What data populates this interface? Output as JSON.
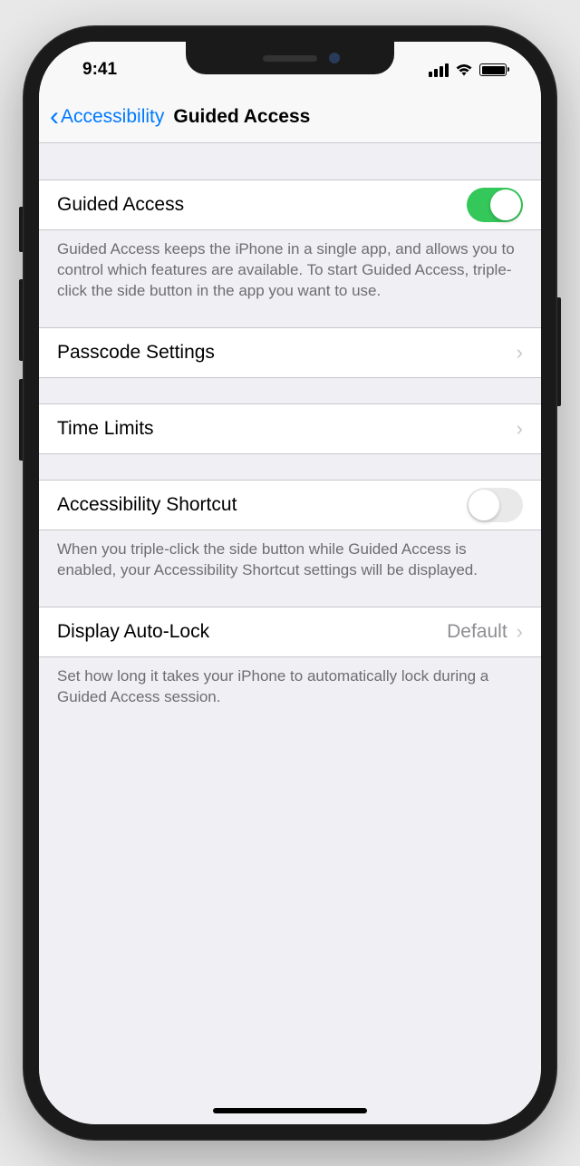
{
  "statusBar": {
    "time": "9:41"
  },
  "navBar": {
    "backLabel": "Accessibility",
    "title": "Guided Access"
  },
  "rows": {
    "guidedAccess": {
      "label": "Guided Access",
      "enabled": true,
      "footer": "Guided Access keeps the iPhone in a single app, and allows you to control which features are available. To start Guided Access, triple-click the side button in the app you want to use."
    },
    "passcode": {
      "label": "Passcode Settings"
    },
    "timeLimits": {
      "label": "Time Limits"
    },
    "accessibilityShortcut": {
      "label": "Accessibility Shortcut",
      "enabled": false,
      "footer": "When you triple-click the side button while Guided Access is enabled, your Accessibility Shortcut settings will be displayed."
    },
    "displayAutoLock": {
      "label": "Display Auto-Lock",
      "value": "Default",
      "footer": "Set how long it takes your iPhone to automatically lock during a Guided Access session."
    }
  }
}
